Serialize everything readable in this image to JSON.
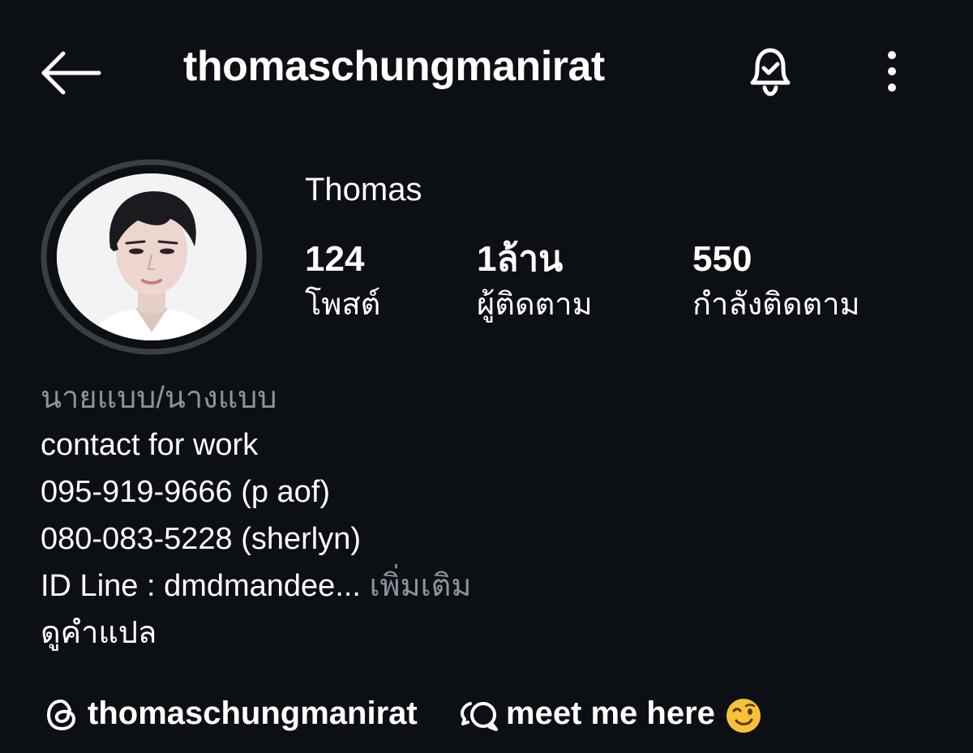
{
  "header": {
    "username": "thomaschungmanirat",
    "icons": {
      "back": "back-arrow-icon",
      "notifications": "bell-check-icon",
      "more": "more-vertical-icon"
    }
  },
  "profile": {
    "display_name": "Thomas",
    "stats": [
      {
        "value": "124",
        "label": "โพสต์"
      },
      {
        "value": "1ล้าน",
        "label": "ผู้ติดตาม"
      },
      {
        "value": "550",
        "label": "กำลังติดตาม"
      }
    ]
  },
  "bio": {
    "category": "นายแบบ/นางแบบ",
    "lines": [
      "contact for work",
      "095-919-9666 (p aof)",
      "080-083-5228 (sherlyn)"
    ],
    "truncated_line": "ID Line : dmdmandee...",
    "more_label": "เพิ่มเติม",
    "translate_label": "ดูคำแปล"
  },
  "links": {
    "threads_handle": "thomaschungmanirat",
    "chat_label": "meet me here",
    "chat_emoji": "winking-face-emoji"
  },
  "colors": {
    "background": "#0c0f14",
    "text": "#ffffff",
    "muted": "#8d939b",
    "ring": "#3a3f46"
  }
}
